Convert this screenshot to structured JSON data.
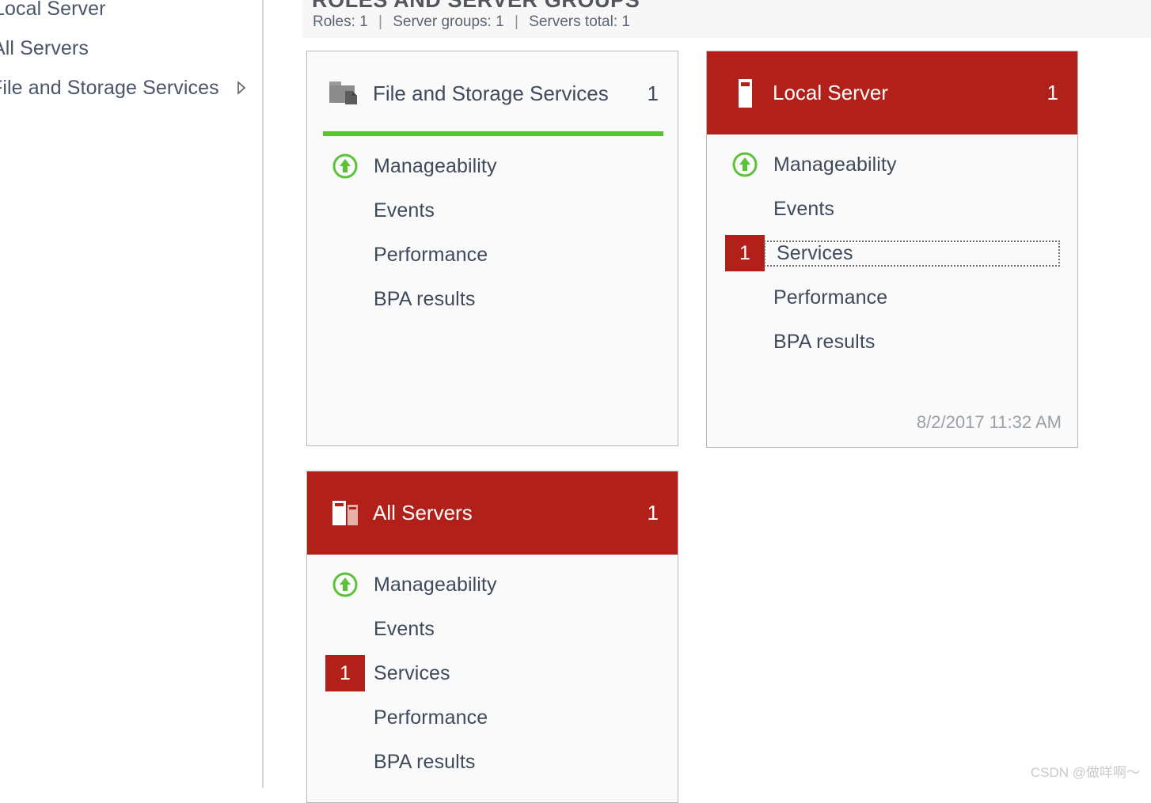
{
  "sidebar": {
    "items": [
      {
        "label": "Local Server",
        "icon": "",
        "has_chevron": false
      },
      {
        "label": "All Servers",
        "icon": "",
        "has_chevron": false
      },
      {
        "label": "File and Storage Services",
        "icon": "chevron-right-icon",
        "has_chevron": true
      }
    ]
  },
  "main": {
    "group_header": {
      "title": "ROLES AND SERVER GROUPS",
      "roles_label": "Roles: 1",
      "server_groups_label": "Server groups: 1",
      "servers_total_label": "Servers total: 1",
      "separator": "|"
    },
    "tiles": [
      {
        "id": "file-storage",
        "title": "File and Storage Services",
        "count": "1",
        "icon": "folder-document-icon",
        "header_style": "light",
        "has_green_bar": true,
        "timestamp": "",
        "rows": [
          {
            "label": "Manageability",
            "marker": "status-up-icon",
            "badge": "",
            "focused": false
          },
          {
            "label": "Events",
            "marker": "",
            "badge": "",
            "focused": false
          },
          {
            "label": "Performance",
            "marker": "",
            "badge": "",
            "focused": false
          },
          {
            "label": "BPA results",
            "marker": "",
            "badge": "",
            "focused": false
          }
        ]
      },
      {
        "id": "local-server",
        "title": "Local Server",
        "count": "1",
        "icon": "server-tower-icon",
        "header_style": "red",
        "has_green_bar": false,
        "timestamp": "8/2/2017 11:32 AM",
        "rows": [
          {
            "label": "Manageability",
            "marker": "status-up-icon",
            "badge": "",
            "focused": false
          },
          {
            "label": "Events",
            "marker": "",
            "badge": "",
            "focused": false
          },
          {
            "label": "Services",
            "marker": "badge",
            "badge": "1",
            "focused": true
          },
          {
            "label": "Performance",
            "marker": "",
            "badge": "",
            "focused": false
          },
          {
            "label": "BPA results",
            "marker": "",
            "badge": "",
            "focused": false
          }
        ]
      },
      {
        "id": "all-servers",
        "title": "All Servers",
        "count": "1",
        "icon": "multi-server-icon",
        "header_style": "red",
        "has_green_bar": false,
        "timestamp": "",
        "rows": [
          {
            "label": "Manageability",
            "marker": "status-up-icon",
            "badge": "",
            "focused": false
          },
          {
            "label": "Events",
            "marker": "",
            "badge": "",
            "focused": false
          },
          {
            "label": "Services",
            "marker": "badge",
            "badge": "1",
            "focused": false
          },
          {
            "label": "Performance",
            "marker": "",
            "badge": "",
            "focused": false
          },
          {
            "label": "BPA results",
            "marker": "",
            "badge": "",
            "focused": false
          }
        ]
      }
    ]
  },
  "watermark": {
    "text": "CSDN @做咩啊～"
  },
  "colors": {
    "accent_red": "#b12119",
    "status_green": "#5bc236",
    "text_primary": "#3f4a5a",
    "tile_border": "#b8b8b8",
    "header_band": "#f7f7f7"
  }
}
